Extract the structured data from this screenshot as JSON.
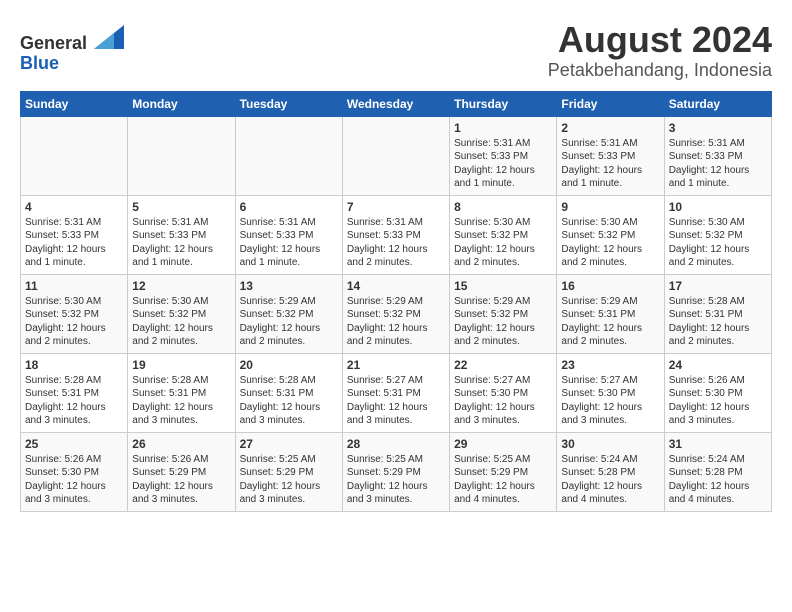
{
  "header": {
    "logo_line1": "General",
    "logo_line2": "Blue",
    "title": "August 2024",
    "subtitle": "Petakbehandang, Indonesia"
  },
  "days_of_week": [
    "Sunday",
    "Monday",
    "Tuesday",
    "Wednesday",
    "Thursday",
    "Friday",
    "Saturday"
  ],
  "weeks": [
    [
      {
        "day": "",
        "info": ""
      },
      {
        "day": "",
        "info": ""
      },
      {
        "day": "",
        "info": ""
      },
      {
        "day": "",
        "info": ""
      },
      {
        "day": "1",
        "info": "Sunrise: 5:31 AM\nSunset: 5:33 PM\nDaylight: 12 hours\nand 1 minute."
      },
      {
        "day": "2",
        "info": "Sunrise: 5:31 AM\nSunset: 5:33 PM\nDaylight: 12 hours\nand 1 minute."
      },
      {
        "day": "3",
        "info": "Sunrise: 5:31 AM\nSunset: 5:33 PM\nDaylight: 12 hours\nand 1 minute."
      }
    ],
    [
      {
        "day": "4",
        "info": "Sunrise: 5:31 AM\nSunset: 5:33 PM\nDaylight: 12 hours\nand 1 minute."
      },
      {
        "day": "5",
        "info": "Sunrise: 5:31 AM\nSunset: 5:33 PM\nDaylight: 12 hours\nand 1 minute."
      },
      {
        "day": "6",
        "info": "Sunrise: 5:31 AM\nSunset: 5:33 PM\nDaylight: 12 hours\nand 1 minute."
      },
      {
        "day": "7",
        "info": "Sunrise: 5:31 AM\nSunset: 5:33 PM\nDaylight: 12 hours\nand 2 minutes."
      },
      {
        "day": "8",
        "info": "Sunrise: 5:30 AM\nSunset: 5:32 PM\nDaylight: 12 hours\nand 2 minutes."
      },
      {
        "day": "9",
        "info": "Sunrise: 5:30 AM\nSunset: 5:32 PM\nDaylight: 12 hours\nand 2 minutes."
      },
      {
        "day": "10",
        "info": "Sunrise: 5:30 AM\nSunset: 5:32 PM\nDaylight: 12 hours\nand 2 minutes."
      }
    ],
    [
      {
        "day": "11",
        "info": "Sunrise: 5:30 AM\nSunset: 5:32 PM\nDaylight: 12 hours\nand 2 minutes."
      },
      {
        "day": "12",
        "info": "Sunrise: 5:30 AM\nSunset: 5:32 PM\nDaylight: 12 hours\nand 2 minutes."
      },
      {
        "day": "13",
        "info": "Sunrise: 5:29 AM\nSunset: 5:32 PM\nDaylight: 12 hours\nand 2 minutes."
      },
      {
        "day": "14",
        "info": "Sunrise: 5:29 AM\nSunset: 5:32 PM\nDaylight: 12 hours\nand 2 minutes."
      },
      {
        "day": "15",
        "info": "Sunrise: 5:29 AM\nSunset: 5:32 PM\nDaylight: 12 hours\nand 2 minutes."
      },
      {
        "day": "16",
        "info": "Sunrise: 5:29 AM\nSunset: 5:31 PM\nDaylight: 12 hours\nand 2 minutes."
      },
      {
        "day": "17",
        "info": "Sunrise: 5:28 AM\nSunset: 5:31 PM\nDaylight: 12 hours\nand 2 minutes."
      }
    ],
    [
      {
        "day": "18",
        "info": "Sunrise: 5:28 AM\nSunset: 5:31 PM\nDaylight: 12 hours\nand 3 minutes."
      },
      {
        "day": "19",
        "info": "Sunrise: 5:28 AM\nSunset: 5:31 PM\nDaylight: 12 hours\nand 3 minutes."
      },
      {
        "day": "20",
        "info": "Sunrise: 5:28 AM\nSunset: 5:31 PM\nDaylight: 12 hours\nand 3 minutes."
      },
      {
        "day": "21",
        "info": "Sunrise: 5:27 AM\nSunset: 5:31 PM\nDaylight: 12 hours\nand 3 minutes."
      },
      {
        "day": "22",
        "info": "Sunrise: 5:27 AM\nSunset: 5:30 PM\nDaylight: 12 hours\nand 3 minutes."
      },
      {
        "day": "23",
        "info": "Sunrise: 5:27 AM\nSunset: 5:30 PM\nDaylight: 12 hours\nand 3 minutes."
      },
      {
        "day": "24",
        "info": "Sunrise: 5:26 AM\nSunset: 5:30 PM\nDaylight: 12 hours\nand 3 minutes."
      }
    ],
    [
      {
        "day": "25",
        "info": "Sunrise: 5:26 AM\nSunset: 5:30 PM\nDaylight: 12 hours\nand 3 minutes."
      },
      {
        "day": "26",
        "info": "Sunrise: 5:26 AM\nSunset: 5:29 PM\nDaylight: 12 hours\nand 3 minutes."
      },
      {
        "day": "27",
        "info": "Sunrise: 5:25 AM\nSunset: 5:29 PM\nDaylight: 12 hours\nand 3 minutes."
      },
      {
        "day": "28",
        "info": "Sunrise: 5:25 AM\nSunset: 5:29 PM\nDaylight: 12 hours\nand 3 minutes."
      },
      {
        "day": "29",
        "info": "Sunrise: 5:25 AM\nSunset: 5:29 PM\nDaylight: 12 hours\nand 4 minutes."
      },
      {
        "day": "30",
        "info": "Sunrise: 5:24 AM\nSunset: 5:28 PM\nDaylight: 12 hours\nand 4 minutes."
      },
      {
        "day": "31",
        "info": "Sunrise: 5:24 AM\nSunset: 5:28 PM\nDaylight: 12 hours\nand 4 minutes."
      }
    ]
  ]
}
